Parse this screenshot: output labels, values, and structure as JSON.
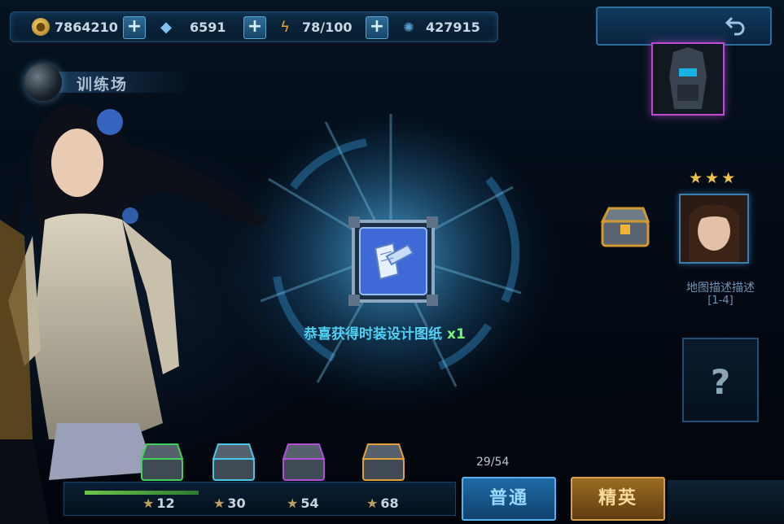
{
  "resources": {
    "gold": {
      "icon": "gold-coin-icon",
      "value": "7864210"
    },
    "diamond": {
      "icon": "diamond-icon",
      "value": "6591"
    },
    "energy": {
      "icon": "lightning-icon",
      "value": "78/100"
    },
    "power": {
      "icon": "crystal-icon",
      "value": "427915"
    }
  },
  "area": {
    "title": "训练场"
  },
  "reward": {
    "message": "恭喜获得时装设计图纸",
    "quantity": "x1",
    "item_icon": "design-blueprint-icon"
  },
  "map": {
    "label": "地图描述描述",
    "sub_label": "[1-4]",
    "stars": [
      "★",
      "★",
      "★"
    ],
    "unknown_label": "?"
  },
  "progress": {
    "text": "29/54",
    "fill_fraction": 0.29
  },
  "chests": [
    {
      "stars": "12",
      "color": "#3fd15a"
    },
    {
      "stars": "30",
      "color": "#46c8e8"
    },
    {
      "stars": "54",
      "color": "#b04fd8"
    },
    {
      "stars": "68",
      "color": "#e2a23a"
    }
  ],
  "buttons": {
    "normal": "普通",
    "elite": "精英"
  },
  "colors": {
    "accent_cyan": "#4fd2f5",
    "quantity_green": "#7df07a",
    "star_gold": "#f0c24e"
  }
}
